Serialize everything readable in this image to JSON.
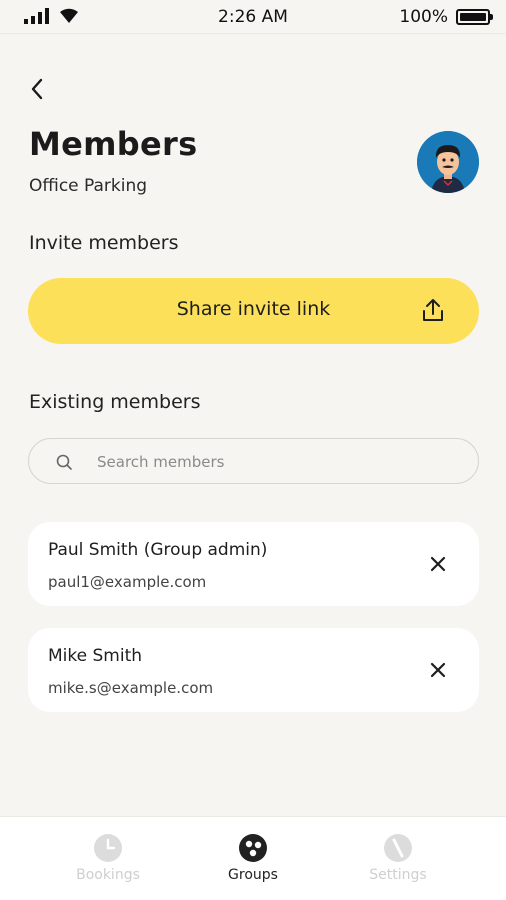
{
  "status_bar": {
    "time": "2:26 AM",
    "battery_percent": "100%",
    "battery_level": 1.0
  },
  "header": {
    "back_icon": "chevron-left-icon",
    "title": "Members",
    "subtitle": "Office Parking",
    "avatar_icon": "user-avatar-icon"
  },
  "invite": {
    "section_label": "Invite members",
    "share_button_label": "Share invite link",
    "share_icon": "upload-share-icon",
    "button_color": "#fde05a"
  },
  "existing": {
    "section_label": "Existing members",
    "search_placeholder": "Search members",
    "search_value": "",
    "members": [
      {
        "name": "Paul Smith (Group admin)",
        "email": "paul1@example.com"
      },
      {
        "name": "Mike Smith",
        "email": "mike.s@example.com"
      }
    ]
  },
  "bottom_nav": {
    "items": [
      {
        "label": "Bookings",
        "icon": "clock-icon",
        "active": false
      },
      {
        "label": "Groups",
        "icon": "groups-icon",
        "active": true
      },
      {
        "label": "Settings",
        "icon": "settings-icon",
        "active": false
      }
    ]
  }
}
